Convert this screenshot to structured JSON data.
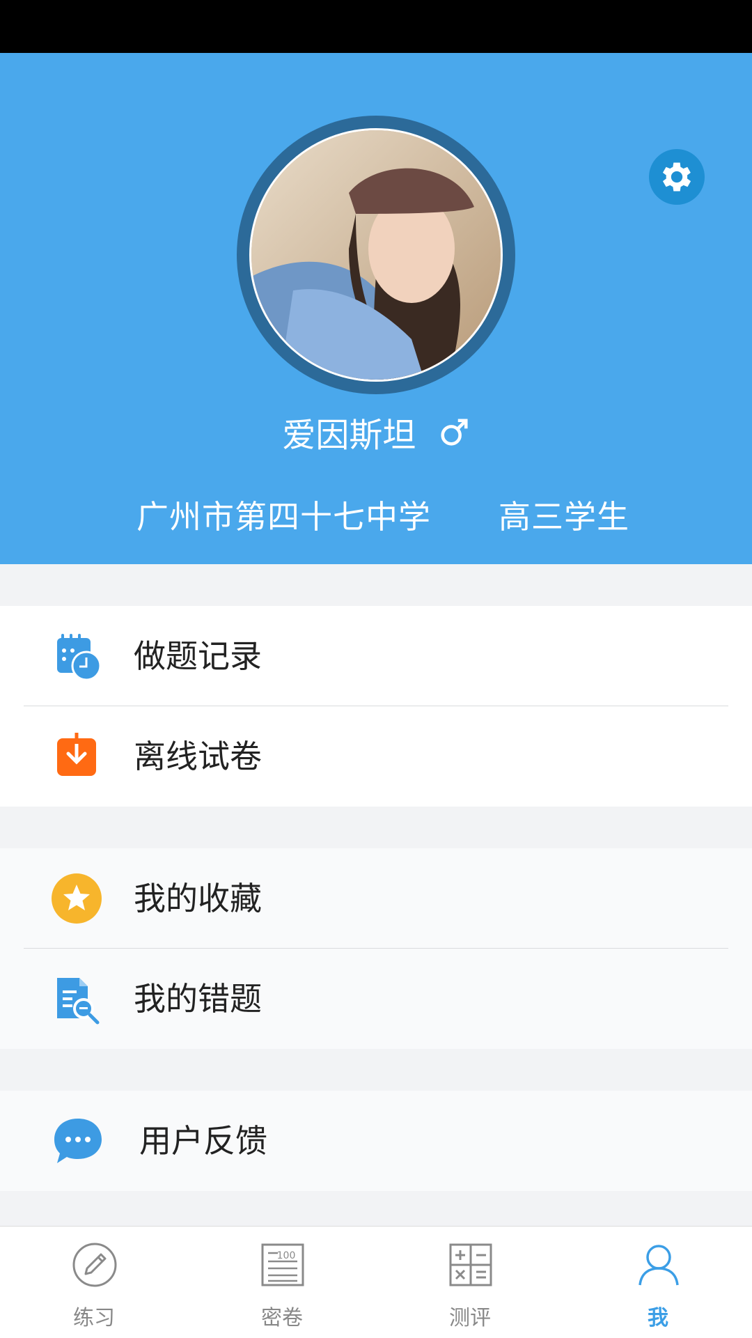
{
  "profile": {
    "name": "爱因斯坦",
    "gender_icon": "male-symbol-icon",
    "school": "广州市第四十七中学",
    "grade": "高三学生"
  },
  "menu": {
    "group1": [
      {
        "label": "做题记录",
        "icon": "calendar-clock-icon"
      },
      {
        "label": "离线试卷",
        "icon": "download-icon"
      }
    ],
    "group2": [
      {
        "label": "我的收藏",
        "icon": "star-icon"
      },
      {
        "label": "我的错题",
        "icon": "document-search-icon"
      }
    ],
    "group3": [
      {
        "label": "用户反馈",
        "icon": "chat-bubble-icon"
      }
    ]
  },
  "tabs": [
    {
      "label": "练习",
      "icon": "pencil-icon"
    },
    {
      "label": "密卷",
      "icon": "paper-100-icon"
    },
    {
      "label": "测评",
      "icon": "calculator-icon"
    },
    {
      "label": "我",
      "icon": "user-icon",
      "active": true
    }
  ],
  "colors": {
    "header_bg": "#4aa8ec",
    "accent": "#3b9ee6",
    "orange": "#ff6a13",
    "star": "#f7b52c"
  }
}
